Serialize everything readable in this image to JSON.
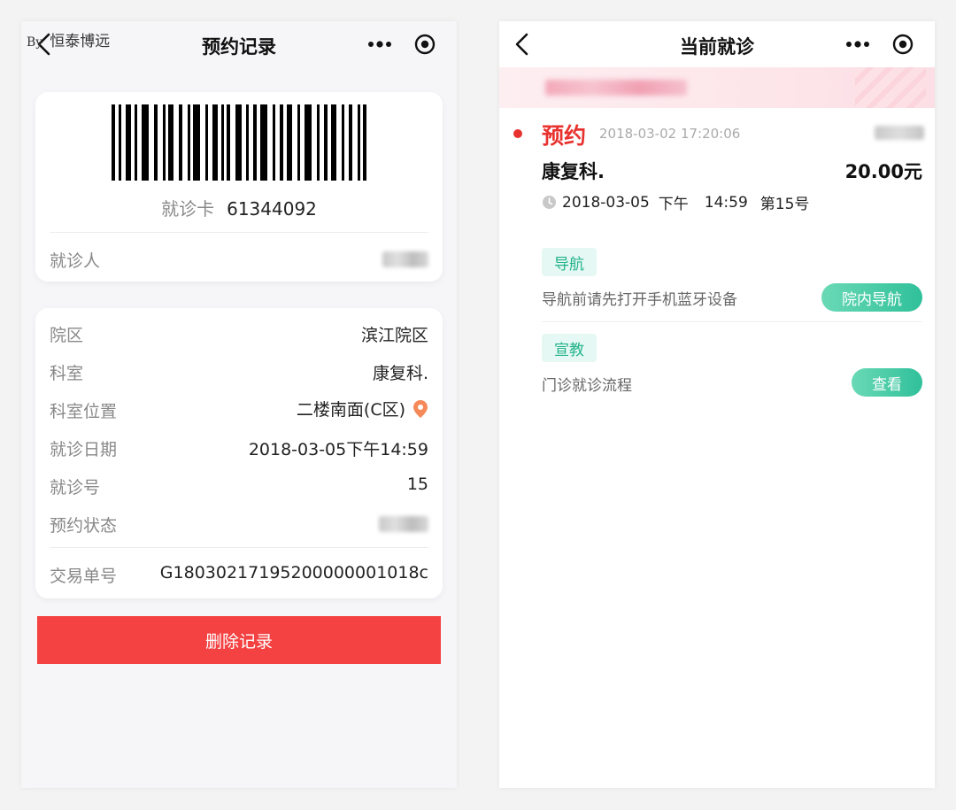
{
  "watermark": {
    "by": "By",
    "text": "恒泰博远"
  },
  "left": {
    "title": "预约记录",
    "card_label": "就诊卡",
    "card_number": "61344092",
    "patient_label": "就诊人",
    "details": [
      {
        "label": "院区",
        "value": "滨江院区"
      },
      {
        "label": "科室",
        "value": "康复科."
      },
      {
        "label": "科室位置",
        "value": "二楼南面(C区)"
      },
      {
        "label": "就诊日期",
        "value": "2018-03-05下午14:59"
      },
      {
        "label": "就诊号",
        "value": "15"
      },
      {
        "label": "预约状态",
        "value": ""
      }
    ],
    "order_label": "交易单号",
    "order_value": "G18030217195200000001018c",
    "delete_label": "删除记录"
  },
  "right": {
    "title": "当前就诊",
    "status": "预约",
    "status_time": "2018-03-02 17:20:06",
    "department": "康复科.",
    "price": "20.00元",
    "visit_date": "2018-03-05",
    "visit_period": "下午",
    "visit_time": "14:59",
    "visit_number": "第15号",
    "nav_tag": "导航",
    "nav_desc": "导航前请先打开手机蓝牙设备",
    "nav_button": "院内导航",
    "edu_tag": "宣教",
    "edu_desc": "门诊就诊流程",
    "edu_button": "查看"
  },
  "colors": {
    "accent_red": "#f44141",
    "status_red": "#e8322f",
    "accent_green": "#2fc09a",
    "pin_orange": "#f5895a"
  }
}
